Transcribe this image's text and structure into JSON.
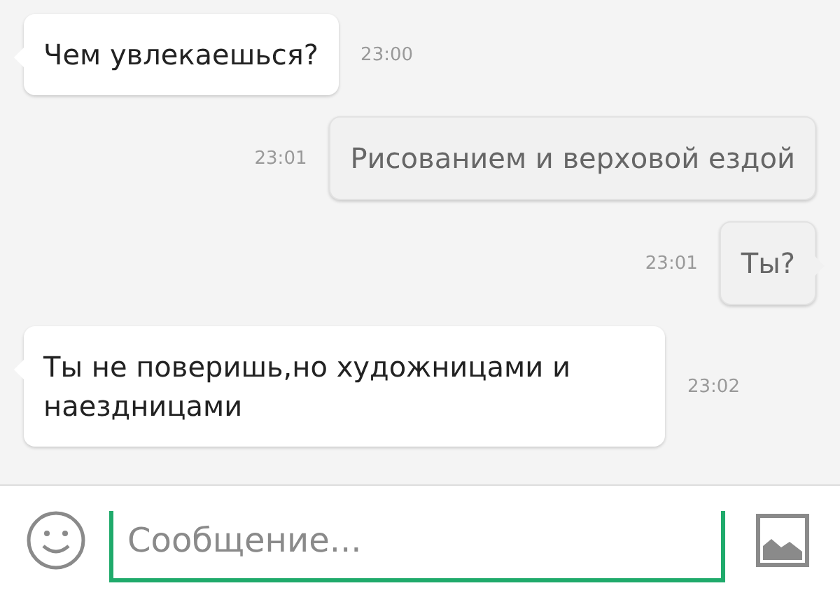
{
  "messages": [
    {
      "kind": "incoming",
      "text": "Чем увлекаешься?",
      "time": "23:00",
      "tail": true
    },
    {
      "kind": "outgoing",
      "text": "Рисованием и верховой ездой",
      "time": "23:01",
      "tail": false
    },
    {
      "kind": "outgoing",
      "text": "Ты?",
      "time": "23:01",
      "tail": true
    },
    {
      "kind": "incoming",
      "text": "Ты не поверишь,но художницами и наездницами",
      "time": "23:02",
      "tail": true
    }
  ],
  "composer": {
    "placeholder": "Сообщение..."
  }
}
